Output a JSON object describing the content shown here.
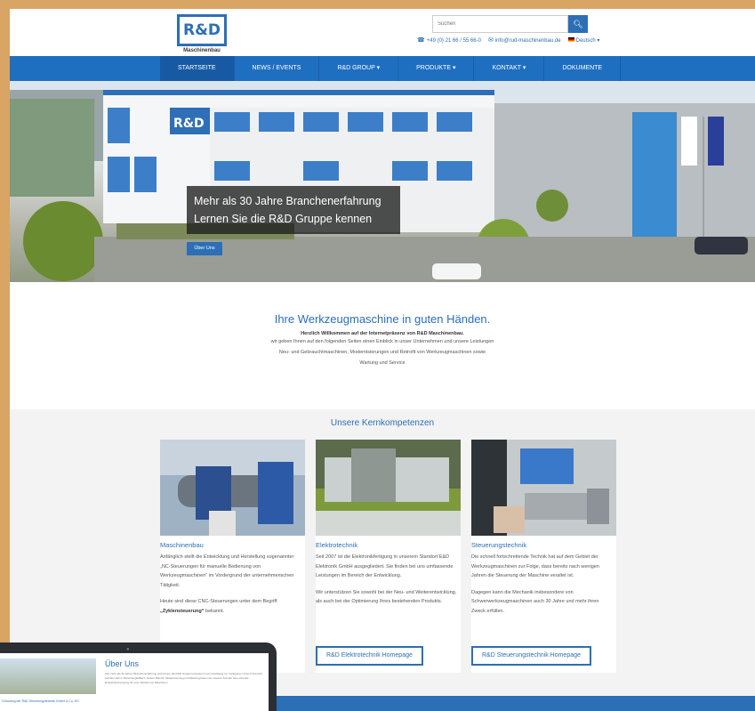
{
  "brand": {
    "logo_text": "R&D",
    "logo_subtitle": "Maschinenbau"
  },
  "header": {
    "search_placeholder": "Suchen",
    "phone": "+49 (0) 21 66 / 55 66-0",
    "email": "info@rud-maschinenbau.de",
    "language": "Deutsch"
  },
  "nav": {
    "items": [
      {
        "label": "STARTSEITE",
        "active": true
      },
      {
        "label": "NEWS / EVENTS"
      },
      {
        "label": "R&D GROUP ▾"
      },
      {
        "label": "PRODUKTE ▾"
      },
      {
        "label": "KONTAKT ▾"
      },
      {
        "label": "DOKUMENTE"
      }
    ]
  },
  "hero": {
    "building_sign": "R&D",
    "caption_line1": "Mehr als 30 Jahre Branchenerfahrung",
    "caption_line2": "Lernen Sie die R&D Gruppe kennen",
    "button": "Über Uns"
  },
  "welcome": {
    "title": "Ihre Werkzeugmaschine in guten Händen.",
    "lead": "Herzlich Willkommen auf der Internetpräsenz von R&D Maschinenbau.",
    "line1": "wir geben Ihnen auf den folgenden Seiten einen Einblick in unser Unternehmen und unsere Leistungen",
    "line2": "Neu- und Gebrauchtmaschinen, Modernisierungen und Retrofit von Werkzeugmaschinen sowie",
    "line3": "Wartung und Service"
  },
  "competences": {
    "title": "Unsere Kernkompetenzen",
    "cards": [
      {
        "title": "Maschinenbau",
        "p1": "Anfänglich stellt die Entwicklung und Herstellung sogenannter „NC-Steuerungen für manuelle Bedienung von Werkzeugmaschinen“ im Vordergrund der unternehmerischen Tätigkeit.",
        "p2a": "Heute sind diese CNC-Steuerungen unter dem Begriff",
        "p2b": "„Zyklensteuerung“",
        "p2c": "bekannt.",
        "button": ""
      },
      {
        "title": "Elektrotechnik",
        "p1": "Seit 2007 ist die Elektronikfertigung in unserem Standort E&D Elektronik GmbH ausgegliedert. Sie finden bei uns umfassende Leistungen im Bereich der Entwicklung.",
        "p2": "Wir unterstützen Sie sowohl bei der Neu- und Weiterentwicklung, als auch bei der Optimierung Ihres bestehenden Produkts.",
        "button": "R&D Elektrotechnik Homepage"
      },
      {
        "title": "Steuerungstechnik",
        "p1": "Die schnell fortschreitende Technik hat auf dem Gebiet der Werkzeugmaschinen zur Folge, dass bereits nach wenigen Jahren die Steuerung der Maschine veraltet ist.",
        "p2": "Dagegen kann die Mechanik insbesondere von Schwerwerkzeugmaschinen auch 30 Jahre und mehr ihren Zweck erfüllen.",
        "button": "R&D Steuerungstechnik Homepage"
      }
    ]
  },
  "tablet": {
    "title": "Über Uns",
    "text": "Seit mehr als 30 Jahren Branchenerfahrung steht Ihnen die R&D Gruppe kompetent und zuverlässig zur Verfügung. Unser Firmensitz befindet sich in Mönchengladbach. Neben Retrofit, Modernisierung und Wartung bieten wir unseren Kunden eine schnelle Ersatzteilversorgung für eine Vielzahl von Maschinen.",
    "footer": "Gründung der R&D Steuerungstechnik GmbH & Co. KG"
  },
  "colors": {
    "brand_blue": "#2c6fb5",
    "nav_blue": "#1f6fc0",
    "frame": "#d8a565"
  },
  "icons": [
    "search-icon",
    "phone-icon",
    "email-icon",
    "flag-icon",
    "camera-icon"
  ]
}
